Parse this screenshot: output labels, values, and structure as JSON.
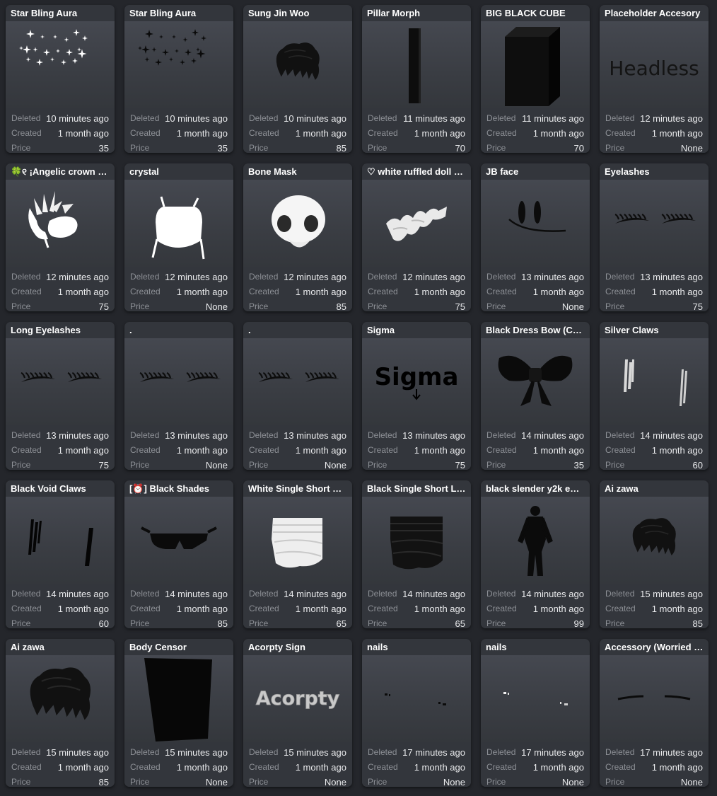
{
  "labels": {
    "deleted": "Deleted",
    "created": "Created",
    "price": "Price"
  },
  "items": [
    {
      "name": "Star Bling Aura",
      "deleted": "10 minutes ago",
      "created": "1 month ago",
      "price": "35",
      "icon": "white-sparkles-icon"
    },
    {
      "name": "Star Bling Aura",
      "deleted": "10 minutes ago",
      "created": "1 month ago",
      "price": "35",
      "icon": "black-sparkles-icon"
    },
    {
      "name": "Sung Jin Woo",
      "deleted": "10 minutes ago",
      "created": "1 month ago",
      "price": "85",
      "icon": "black-hair-icon"
    },
    {
      "name": "Pillar Morph",
      "deleted": "11 minutes ago",
      "created": "1 month ago",
      "price": "70",
      "icon": "black-pillar-icon"
    },
    {
      "name": "BIG BLACK CUBE",
      "deleted": "11 minutes ago",
      "created": "1 month ago",
      "price": "70",
      "icon": "black-cube-icon"
    },
    {
      "name": "Placeholder Accesory",
      "deleted": "12 minutes ago",
      "created": "1 month ago",
      "price": "None",
      "icon": "headless-text-icon",
      "thumb_text": "Headless"
    },
    {
      "name": "🍀୧ ¡Angelic crown :…",
      "deleted": "12 minutes ago",
      "created": "1 month ago",
      "price": "75",
      "icon": "angelic-crown-icon"
    },
    {
      "name": "crystal",
      "deleted": "12 minutes ago",
      "created": "1 month ago",
      "price": "None",
      "icon": "white-mask-icon"
    },
    {
      "name": "Bone Mask",
      "deleted": "12 minutes ago",
      "created": "1 month ago",
      "price": "85",
      "icon": "bone-mask-icon"
    },
    {
      "name": "♡ white ruffled doll s…",
      "deleted": "12 minutes ago",
      "created": "1 month ago",
      "price": "75",
      "icon": "ruffle-icon"
    },
    {
      "name": "JB face",
      "deleted": "13 minutes ago",
      "created": "1 month ago",
      "price": "None",
      "icon": "face-icon"
    },
    {
      "name": "Eyelashes",
      "deleted": "13 minutes ago",
      "created": "1 month ago",
      "price": "75",
      "icon": "eyelashes-icon"
    },
    {
      "name": "Long Eyelashes",
      "deleted": "13 minutes ago",
      "created": "1 month ago",
      "price": "75",
      "icon": "eyelashes-icon"
    },
    {
      "name": ".",
      "deleted": "13 minutes ago",
      "created": "1 month ago",
      "price": "None",
      "icon": "eyelashes-icon"
    },
    {
      "name": ".",
      "deleted": "13 minutes ago",
      "created": "1 month ago",
      "price": "None",
      "icon": "eyelashes-icon"
    },
    {
      "name": "Sigma",
      "deleted": "13 minutes ago",
      "created": "1 month ago",
      "price": "75",
      "icon": "sigma-text-icon",
      "thumb_text": "Sigma"
    },
    {
      "name": "Black Dress Bow (Chi…",
      "deleted": "14 minutes ago",
      "created": "1 month ago",
      "price": "35",
      "icon": "bow-icon"
    },
    {
      "name": "Silver Claws",
      "deleted": "14 minutes ago",
      "created": "1 month ago",
      "price": "60",
      "icon": "silver-claws-icon"
    },
    {
      "name": "Black Void Claws",
      "deleted": "14 minutes ago",
      "created": "1 month ago",
      "price": "60",
      "icon": "black-claws-icon"
    },
    {
      "name": "[⏰] Black Shades",
      "deleted": "14 minutes ago",
      "created": "1 month ago",
      "price": "85",
      "icon": "sunglasses-icon"
    },
    {
      "name": "White Single Short L…",
      "deleted": "14 minutes ago",
      "created": "1 month ago",
      "price": "65",
      "icon": "white-legwarmer-icon"
    },
    {
      "name": "Black Single Short Le…",
      "deleted": "14 minutes ago",
      "created": "1 month ago",
      "price": "65",
      "icon": "black-legwarmer-icon"
    },
    {
      "name": "black slender y2k e…",
      "deleted": "14 minutes ago",
      "created": "1 month ago",
      "price": "99",
      "icon": "body-icon"
    },
    {
      "name": "Ai zawa",
      "deleted": "15 minutes ago",
      "created": "1 month ago",
      "price": "85",
      "icon": "black-hair-icon"
    },
    {
      "name": "Ai zawa",
      "deleted": "15 minutes ago",
      "created": "1 month ago",
      "price": "85",
      "icon": "black-hair-large-icon"
    },
    {
      "name": "Body Censor",
      "deleted": "15 minutes ago",
      "created": "1 month ago",
      "price": "None",
      "icon": "black-panel-icon"
    },
    {
      "name": "Acorpty Sign",
      "deleted": "15 minutes ago",
      "created": "1 month ago",
      "price": "None",
      "icon": "acorpty-text-icon",
      "thumb_text": "Acorpty"
    },
    {
      "name": "nails",
      "deleted": "17 minutes ago",
      "created": "1 month ago",
      "price": "None",
      "icon": "black-nails-icon"
    },
    {
      "name": "nails",
      "deleted": "17 minutes ago",
      "created": "1 month ago",
      "price": "None",
      "icon": "white-nails-icon"
    },
    {
      "name": "Accessory (Worried …",
      "deleted": "17 minutes ago",
      "created": "1 month ago",
      "price": "None",
      "icon": "eyebrows-icon"
    }
  ]
}
